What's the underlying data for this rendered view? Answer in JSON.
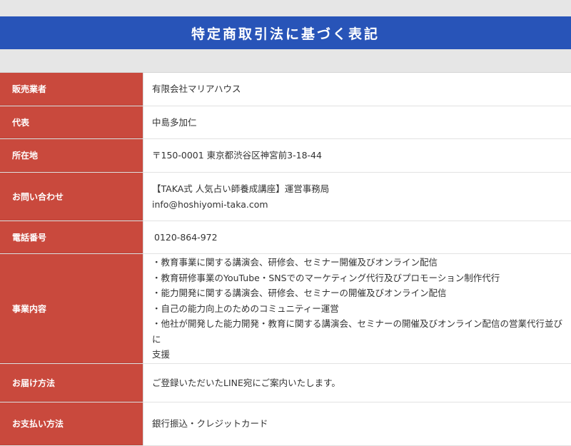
{
  "page": {
    "title": "特定商取引法に基づく表記"
  },
  "rows": [
    {
      "label": "販売業者",
      "value": "有限会社マリアハウス"
    },
    {
      "label": "代表",
      "value": "中島多加仁"
    },
    {
      "label": "所在地",
      "value": "〒150-0001 東京都渋谷区神宮前3-18-44"
    },
    {
      "label": "お問い合わせ",
      "lines": [
        "【TAKA式 人気占い師養成講座】運営事務局",
        "info@hoshiyomi-taka.com"
      ]
    },
    {
      "label": "電話番号",
      "value": " 0120-864-972"
    },
    {
      "label": "事業内容",
      "lines": [
        "・教育事業に関する講演会、研修会、セミナー開催及びオンライン配信",
        "・教育研修事業のYouTube・SNSでのマーケティング代行及びプロモーション制作代行",
        "・能力開発に関する講演会、研修会、セミナーの開催及びオンライン配信",
        "・自己の能力向上のためのコミュニティー運営",
        "・他社が開発した能力開発・教育に関する講演会、セミナーの開催及びオンライン配信の営業代行並びに",
        "支援"
      ]
    },
    {
      "label": "お届け方法",
      "value": "ご登録いただいたLINE宛にご案内いたします。"
    },
    {
      "label": "お支払い方法",
      "value": "銀行振込・クレジットカード"
    }
  ]
}
